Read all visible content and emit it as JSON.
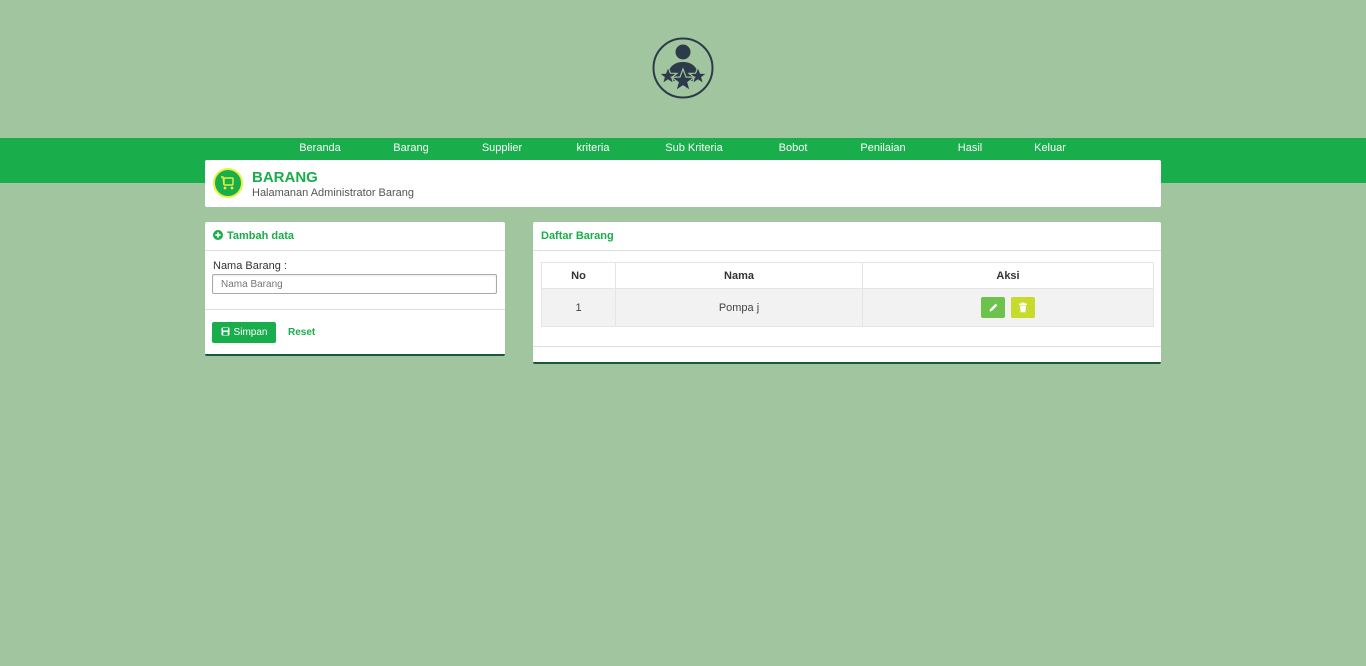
{
  "logo": {
    "icon": "user-stars-logo"
  },
  "nav": {
    "items": [
      "Beranda",
      "Barang",
      "Supplier",
      "kriteria",
      "Sub Kriteria",
      "Bobot",
      "Penilaian",
      "Hasil",
      "Keluar"
    ]
  },
  "header": {
    "icon": "cart-icon",
    "title": "BARANG",
    "subtitle": "Halamanan Administrator Barang"
  },
  "form": {
    "title": "Tambah data",
    "field_label": "Nama Barang :",
    "field_placeholder": "Nama Barang",
    "field_value": "",
    "save_label": "Simpan",
    "reset_label": "Reset"
  },
  "list": {
    "title": "Daftar Barang",
    "columns": [
      "No",
      "Nama",
      "Aksi"
    ],
    "rows": [
      {
        "no": "1",
        "nama": "Pompa j"
      }
    ]
  },
  "colors": {
    "background": "#a1c69f",
    "primary": "#19ad4b",
    "accent_yellow": "#c8da2b",
    "edit_green": "#6cc24a",
    "dark_border": "#155a3b"
  }
}
